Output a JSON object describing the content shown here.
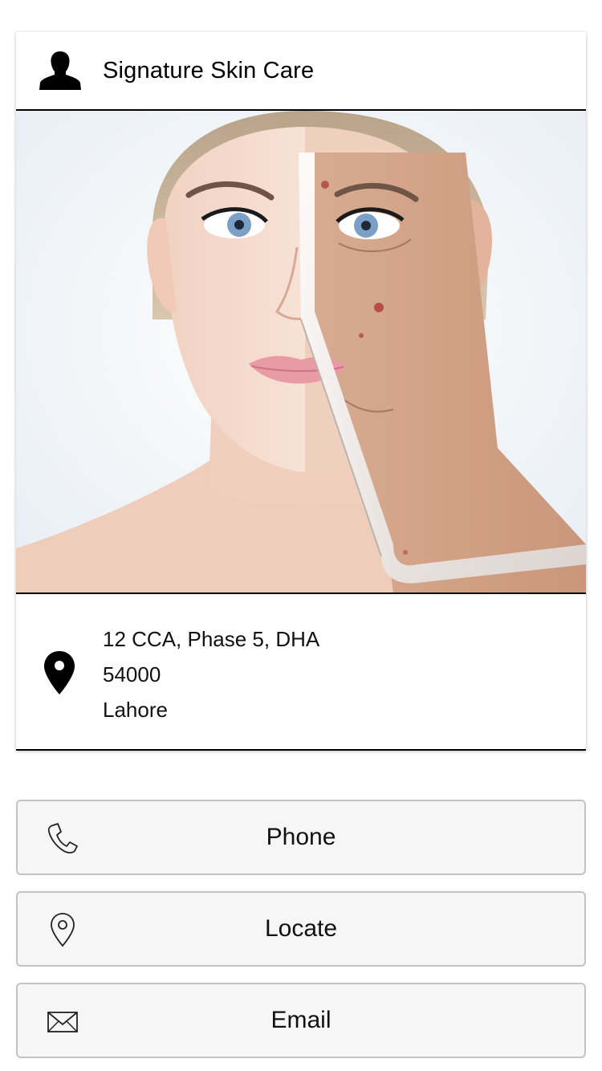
{
  "profile": {
    "name": "Signature Skin Care",
    "avatar_icon": "person-silhouette-icon",
    "photo_alt": "Face with peeled skin comparison"
  },
  "address": {
    "icon": "map-pin-icon",
    "lines": [
      "12 CCA, Phase 5, DHA",
      "54000",
      "Lahore"
    ]
  },
  "actions": [
    {
      "label": "Phone",
      "icon": "phone-icon"
    },
    {
      "label": "Locate",
      "icon": "location-outline-icon"
    },
    {
      "label": "Email",
      "icon": "envelope-icon"
    }
  ],
  "colors": {
    "card_border": "#000000",
    "button_bg": "#f7f6f7",
    "button_border": "#c3c3c3"
  }
}
